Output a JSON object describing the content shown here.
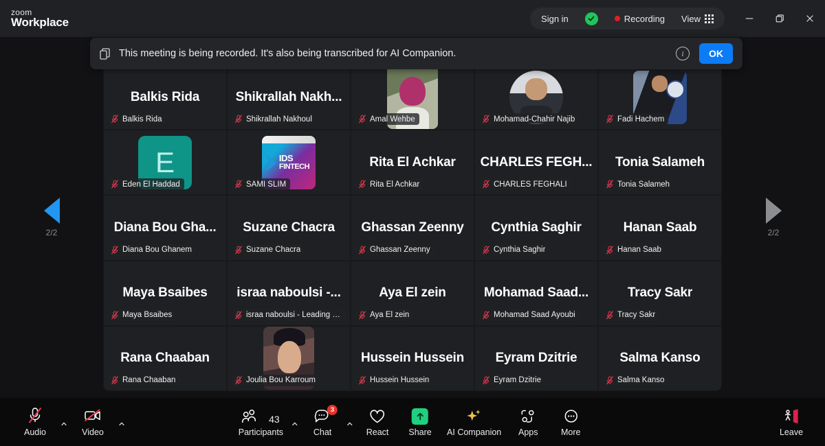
{
  "titlebar": {
    "brand_top": "zoom",
    "brand_bottom": "Workplace",
    "sign_in": "Sign in",
    "shield_icon": "verified-shield-icon",
    "recording": "Recording",
    "view": "View",
    "view_icon": "grid-view-icon",
    "minimize_icon": "minimize-icon",
    "restore_icon": "restore-window-icon",
    "close_icon": "close-icon"
  },
  "banner": {
    "copy_icon": "copy-icon",
    "message": "This meeting is being recorded. It's also being transcribed for AI Companion.",
    "info_icon": "info-icon",
    "ok_label": "OK"
  },
  "gallery": {
    "pager_left": {
      "icon": "chevron-left-triangle-icon",
      "label": "2/2",
      "active": true
    },
    "pager_right": {
      "icon": "chevron-right-triangle-icon",
      "label": "2/2",
      "active": false
    },
    "participants": [
      {
        "display": "Balkis Rida",
        "name": "Balkis Rida",
        "muted": true,
        "media": null
      },
      {
        "display": "Shikrallah  Nakh...",
        "name": "Shikrallah Nakhoul",
        "muted": true,
        "media": null
      },
      {
        "display": "Amal Wehbe",
        "name": "Amal Wehbe",
        "muted": true,
        "media": "video-amal"
      },
      {
        "display": "Mohamad-Chahir Najib",
        "name": "Mohamad-Chahir Najib",
        "muted": true,
        "media": "video-najib"
      },
      {
        "display": "Fadi Hachem",
        "name": "Fadi Hachem",
        "muted": true,
        "media": "video-fadi"
      },
      {
        "display": "E",
        "name": "Eden El Haddad",
        "muted": true,
        "media": "avatar-initial-E"
      },
      {
        "display": "SAMI SLIM",
        "name": "SAMI SLIM",
        "muted": true,
        "media": "video-ids-fintech"
      },
      {
        "display": "Rita El Achkar",
        "name": "Rita El Achkar",
        "muted": true,
        "media": null
      },
      {
        "display": "CHARLES  FEGH...",
        "name": "CHARLES FEGHALI",
        "muted": true,
        "media": null
      },
      {
        "display": "Tonia Salameh",
        "name": "Tonia Salameh",
        "muted": true,
        "media": null
      },
      {
        "display": "Diana  Bou  Gha...",
        "name": "Diana Bou Ghanem",
        "muted": true,
        "media": null
      },
      {
        "display": "Suzane Chacra",
        "name": "Suzane Chacra",
        "muted": true,
        "media": null
      },
      {
        "display": "Ghassan Zeenny",
        "name": "Ghassan Zeenny",
        "muted": true,
        "media": null
      },
      {
        "display": "Cynthia Saghir",
        "name": "Cynthia Saghir",
        "muted": true,
        "media": null
      },
      {
        "display": "Hanan Saab",
        "name": "Hanan Saab",
        "muted": true,
        "media": null
      },
      {
        "display": "Maya Bsaibes",
        "name": "Maya Bsaibes",
        "muted": true,
        "media": null
      },
      {
        "display": "israa  naboulsi  -...",
        "name": "israa naboulsi - Leading Ha...",
        "muted": true,
        "media": null
      },
      {
        "display": "Aya El zein",
        "name": "Aya El zein",
        "muted": true,
        "media": null
      },
      {
        "display": "Mohamad  Saad...",
        "name": "Mohamad Saad Ayoubi",
        "muted": true,
        "media": null
      },
      {
        "display": "Tracy Sakr",
        "name": "Tracy Sakr",
        "muted": true,
        "media": null
      },
      {
        "display": "Rana Chaaban",
        "name": "Rana Chaaban",
        "muted": true,
        "media": null
      },
      {
        "display": "Joulia Bou Karroum",
        "name": "Joulia Bou Karroum",
        "muted": true,
        "media": "video-joulia"
      },
      {
        "display": "Hussein Hussein",
        "name": "Hussein Hussein",
        "muted": true,
        "media": null
      },
      {
        "display": "Eyram Dzitrie",
        "name": "Eyram Dzitrie",
        "muted": true,
        "media": null
      },
      {
        "display": "Salma Kanso",
        "name": "Salma Kanso",
        "muted": true,
        "media": null
      }
    ]
  },
  "toolbar": {
    "audio": {
      "label": "Audio",
      "icon": "microphone-muted-icon",
      "has_caret": true
    },
    "video": {
      "label": "Video",
      "icon": "camera-muted-icon",
      "has_caret": true
    },
    "participants": {
      "label": "Participants",
      "icon": "participants-icon",
      "count": "43",
      "has_caret": true
    },
    "chat": {
      "label": "Chat",
      "icon": "chat-bubble-icon",
      "badge": "3",
      "has_caret": true
    },
    "react": {
      "label": "React",
      "icon": "heart-icon"
    },
    "share": {
      "label": "Share",
      "icon": "share-screen-icon"
    },
    "ai_companion": {
      "label": "AI Companion",
      "icon": "sparkle-icon"
    },
    "apps": {
      "label": "Apps",
      "icon": "apps-icon"
    },
    "more": {
      "label": "More",
      "icon": "ellipsis-icon"
    },
    "leave": {
      "label": "Leave",
      "icon": "leave-door-icon"
    }
  },
  "colors": {
    "accent_blue": "#0b7cf5",
    "recording_red": "#e02020",
    "leave_red": "#e0214a",
    "share_green": "#1fd17f",
    "mute_red": "#e5384f",
    "avatar_teal": "#0f9488"
  }
}
